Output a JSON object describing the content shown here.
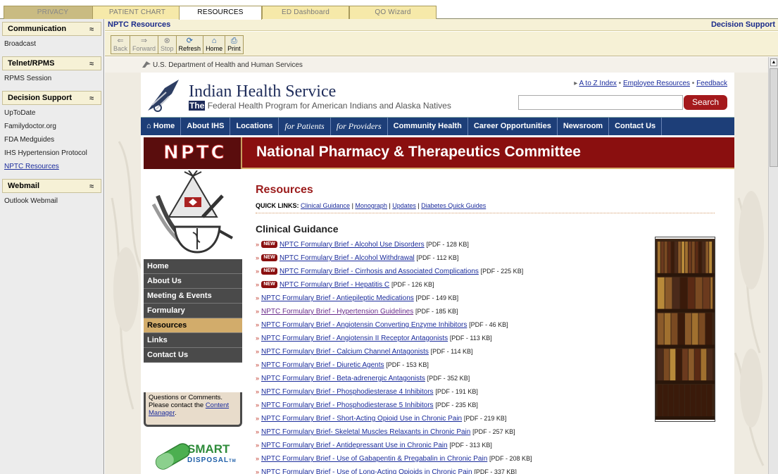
{
  "tabs": [
    "PRIVACY",
    "PATIENT CHART",
    "RESOURCES",
    "ED Dashboard",
    "QO Wizard"
  ],
  "active_tab": "RESOURCES",
  "header": {
    "left": "NPTC Resources",
    "right": "Decision Support"
  },
  "toolbar": [
    {
      "label": "Back",
      "icon": "back-arrow-icon",
      "enabled": false
    },
    {
      "label": "Forward",
      "icon": "forward-arrow-icon",
      "enabled": false
    },
    {
      "label": "Stop",
      "icon": "stop-icon",
      "enabled": false
    },
    {
      "label": "Refresh",
      "icon": "refresh-icon",
      "enabled": true
    },
    {
      "label": "Home",
      "icon": "home-icon",
      "enabled": true
    },
    {
      "label": "Print",
      "icon": "print-icon",
      "enabled": true
    }
  ],
  "sidebar": {
    "sections": [
      {
        "title": "Communication",
        "items": [
          "Broadcast"
        ]
      },
      {
        "title": "Telnet/RPMS",
        "items": [
          "RPMS Session"
        ]
      },
      {
        "title": "Decision Support",
        "items": [
          "UpToDate",
          "Familydoctor.org",
          "FDA Medguides",
          "IHS Hypertension Protocol",
          "NPTC Resources"
        ]
      },
      {
        "title": "Webmail",
        "items": [
          "Outlook Webmail"
        ]
      }
    ]
  },
  "site": {
    "hhs": "U.S. Department of Health and Human Services",
    "title": "Indian Health Service",
    "subtitle_the": "The",
    "subtitle_rest": "Federal Health Program for American Indians and Alaska Natives",
    "top_links": [
      "A to Z Index",
      "Employee Resources",
      "Feedback"
    ],
    "search_button": "Search",
    "search_placeholder": "",
    "nav": [
      "Home",
      "About IHS",
      "Locations",
      "for Patients",
      "for Providers",
      "Community Health",
      "Career Opportunities",
      "Newsroom",
      "Contact Us"
    ],
    "banner_logo": "NPTC",
    "banner_title": "National Pharmacy & Therapeutics Committee",
    "left_nav": [
      "Home",
      "About Us",
      "Meeting & Events",
      "Formulary",
      "Resources",
      "Links",
      "Contact Us"
    ],
    "left_nav_active": "Resources",
    "questions_text": "Questions or Comments. Please contact the ",
    "questions_link": "Content Manager",
    "questions_end": ".",
    "smart_title": "SMART",
    "smart_sub": "DISPOSAL",
    "smart_tm": "TM"
  },
  "main": {
    "title": "Resources",
    "quick_label": "QUICK LINKS:",
    "quick_links": [
      "Clinical Guidance",
      "Monograph",
      "Updates",
      "Diabetes Quick Guides"
    ],
    "section_title": "Clinical Guidance",
    "new_badge": "NEW",
    "documents": [
      {
        "title": "NPTC Formulary Brief - Alcohol Use Disorders",
        "meta": "[PDF - 128 KB]",
        "new": true,
        "visited": false
      },
      {
        "title": "NPTC Formulary Brief - Alcohol Withdrawal",
        "meta": "[PDF - 112 KB]",
        "new": true,
        "visited": false
      },
      {
        "title": "NPTC Formulary Brief - Cirrhosis and Associated Complications",
        "meta": "[PDF - 225 KB]",
        "new": true,
        "visited": false
      },
      {
        "title": "NPTC Formulary Brief - Hepatitis C",
        "meta": "[PDF - 126 KB]",
        "new": true,
        "visited": false
      },
      {
        "title": "NPTC Formulary Brief - Antiepileptic Medications",
        "meta": "[PDF - 149 KB]",
        "new": false,
        "visited": false
      },
      {
        "title": "NPTC Formulary Brief - Hypertension Guidelines",
        "meta": "[PDF - 185 KB]",
        "new": false,
        "visited": true
      },
      {
        "title": "NPTC Formulary Brief - Angiotensin Converting Enzyme Inhibitors",
        "meta": "[PDF - 46 KB]",
        "new": false,
        "visited": false
      },
      {
        "title": "NPTC Formulary Brief - Angiotensin II Receptor Antagonists",
        "meta": "[PDF - 113 KB]",
        "new": false,
        "visited": false
      },
      {
        "title": "NPTC Formulary Brief - Calcium Channel Antagonists",
        "meta": "[PDF - 114 KB]",
        "new": false,
        "visited": false
      },
      {
        "title": "NPTC Formulary Brief - Diuretic Agents",
        "meta": "[PDF - 153 KB]",
        "new": false,
        "visited": false
      },
      {
        "title": "NPTC Formulary Brief - Beta-adrenergic Antagonists",
        "meta": "[PDF - 352 KB]",
        "new": false,
        "visited": false
      },
      {
        "title": "NPTC Formulary Brief - Phosphodiesterase 4 Inhibitors",
        "meta": "[PDF - 191 KB]",
        "new": false,
        "visited": false
      },
      {
        "title": "NPTC Formulary Brief - Phosphodiesterase 5 Inhibitors",
        "meta": "[PDF - 235 KB]",
        "new": false,
        "visited": false
      },
      {
        "title": "NPTC Formulary Brief - Short-Acting Opioid Use in Chronic Pain",
        "meta": "[PDF - 219 KB]",
        "new": false,
        "visited": false
      },
      {
        "title": "NPTC Formulary Brief- Skeletal Muscles Relaxants in Chronic Pain",
        "meta": "[PDF - 257 KB]",
        "new": false,
        "visited": false
      },
      {
        "title": "NPTC Formulary Brief - Antidepressant Use in Chronic Pain",
        "meta": "[PDF - 313 KB]",
        "new": false,
        "visited": false
      },
      {
        "title": "NPTC Formulary Brief - Use of Gabapentin & Pregabalin in Chronic Pain",
        "meta": "[PDF - 208 KB]",
        "new": false,
        "visited": false
      },
      {
        "title": "NPTC Formulary Brief - Use of Long-Acting Opioids in Chronic Pain",
        "meta": "[PDF - 337 KB]",
        "new": false,
        "visited": false
      }
    ]
  }
}
